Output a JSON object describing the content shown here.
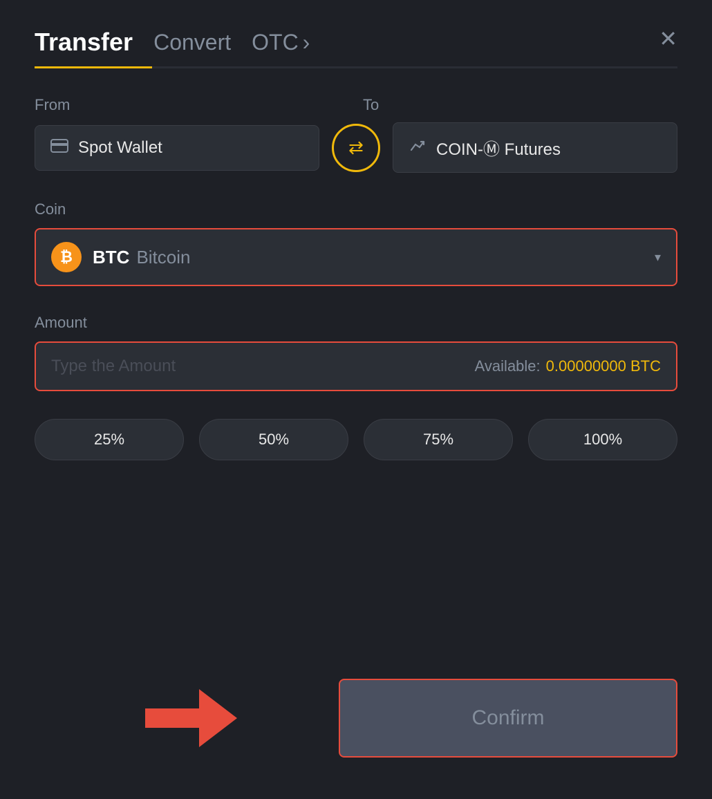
{
  "header": {
    "tab_transfer": "Transfer",
    "tab_convert": "Convert",
    "tab_otc": "OTC",
    "otc_chevron": "›",
    "close": "✕"
  },
  "from_section": {
    "label": "From",
    "wallet_name": "Spot Wallet"
  },
  "to_section": {
    "label": "To",
    "futures_name": "COIN-Ⓜ Futures"
  },
  "coin_section": {
    "label": "Coin",
    "symbol": "BTC",
    "name": "Bitcoin",
    "btc_char": "₿"
  },
  "amount_section": {
    "label": "Amount",
    "placeholder": "Type the Amount",
    "available_label": "Available:",
    "available_value": "0.00000000 BTC"
  },
  "pct_buttons": [
    "25%",
    "50%",
    "75%",
    "100%"
  ],
  "confirm_button": "Confirm"
}
